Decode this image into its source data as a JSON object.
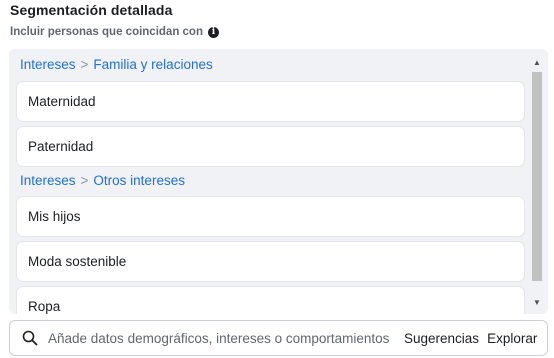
{
  "header": {
    "title": "Segmentación detallada",
    "subtitle": "Incluir personas que coincidan con",
    "info_icon": "info-icon"
  },
  "results": {
    "groups": [
      {
        "category_root": "Intereses",
        "separator": ">",
        "category_sub": "Familia y relaciones",
        "items": [
          "Maternidad",
          "Paternidad"
        ]
      },
      {
        "category_root": "Intereses",
        "separator": ">",
        "category_sub": "Otros intereses",
        "items": [
          "Mis hijos",
          "Moda sostenible",
          "Ropa"
        ]
      }
    ],
    "scroll_up_icon": "triangle-up-icon",
    "scroll_down_icon": "triangle-down-icon"
  },
  "search": {
    "icon": "search-icon",
    "placeholder": "Añade datos demográficos, intereses o comportamientos",
    "suggestions_label": "Sugerencias",
    "explore_label": "Explorar"
  },
  "colors": {
    "link_blue": "#216fdb",
    "panel_bg": "#f0f2f5",
    "text": "#1c1e21"
  }
}
